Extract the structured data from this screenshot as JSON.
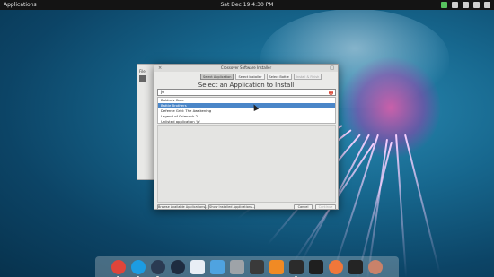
{
  "top_panel": {
    "applications_label": "Applications",
    "clock": "Sat Dec 19    4:30 PM"
  },
  "background_window": {
    "menu_label": "File"
  },
  "dialog": {
    "title": "Crossover Software Installer",
    "steps": [
      {
        "label": "Select Application",
        "state": "active"
      },
      {
        "label": "Select Installer",
        "state": "normal"
      },
      {
        "label": "Select Bottle",
        "state": "normal"
      },
      {
        "label": "Install & Finish",
        "state": "disabled"
      }
    ],
    "heading": "Select an Application to Install",
    "search": {
      "value": "jo"
    },
    "results": [
      {
        "label": "Baldur's Gate",
        "selected": false
      },
      {
        "label": "Battle Brothers",
        "selected": true
      },
      {
        "label": "Defense Grid: The Awakening",
        "selected": false
      },
      {
        "label": "Legend of Grimrock 2",
        "selected": false
      },
      {
        "label": "Unlisted application 'jo'",
        "selected": false
      }
    ],
    "buttons": {
      "browse": "Browse Available Applications...",
      "show_installed": "Show Installed Applications...",
      "cancel": "Cancel",
      "continue": "Continue"
    }
  },
  "dock": {
    "icons": [
      {
        "name": "chrome-icon",
        "color": "#e0453a"
      },
      {
        "name": "skype-icon",
        "color": "#1c9ce3"
      },
      {
        "name": "steam-icon",
        "color": "#2a3a52"
      },
      {
        "name": "steam-alt-icon",
        "color": "#1e2c40"
      },
      {
        "name": "document-viewer-icon",
        "color": "#e8eef5"
      },
      {
        "name": "image-viewer-icon",
        "color": "#4fa3e0"
      },
      {
        "name": "calculator-icon",
        "color": "#9ea3a8"
      },
      {
        "name": "screenshot-icon",
        "color": "#3a3a3a"
      },
      {
        "name": "music-icon",
        "color": "#f08a24"
      },
      {
        "name": "terminal-icon",
        "color": "#2b2b2b"
      },
      {
        "name": "terminal-alt-icon",
        "color": "#1f1f1f"
      },
      {
        "name": "software-center-icon",
        "color": "#f0773a"
      },
      {
        "name": "terminal-dark-icon",
        "color": "#242424"
      },
      {
        "name": "trash-icon",
        "color": "#c9826a"
      }
    ]
  }
}
